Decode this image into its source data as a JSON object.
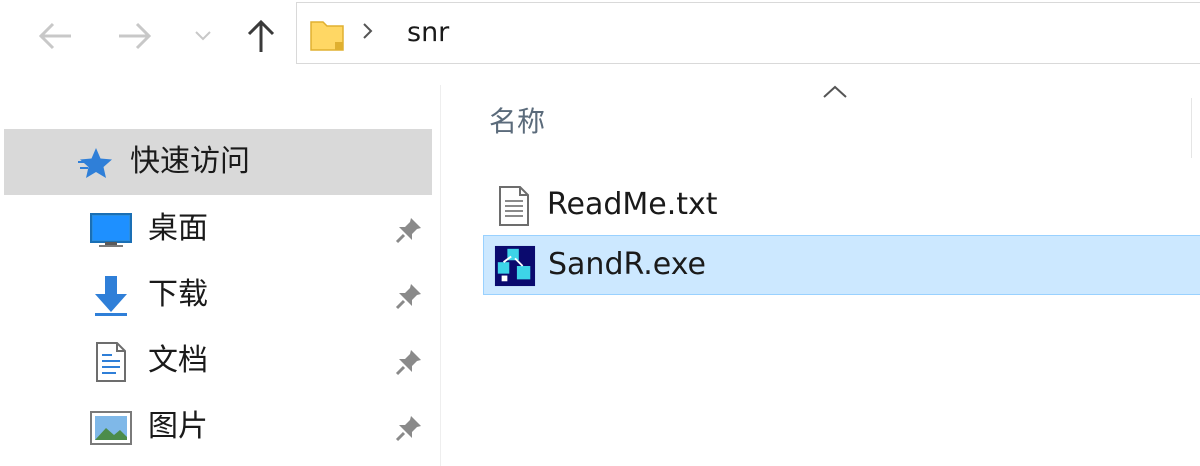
{
  "toolbar": {
    "back_icon": "arrow-left-icon",
    "forward_icon": "arrow-right-icon",
    "recent_icon": "chevron-down-icon",
    "up_icon": "arrow-up-icon"
  },
  "address": {
    "folder_icon": "folder-icon",
    "separator_icon": "chevron-right-icon",
    "crumb": "snr"
  },
  "sidebar": {
    "quick_access": {
      "label": "快速访问",
      "icon": "star-icon"
    },
    "items": [
      {
        "label": "桌面",
        "icon": "desktop-icon",
        "pinned": true
      },
      {
        "label": "下载",
        "icon": "download-icon",
        "pinned": true
      },
      {
        "label": "文档",
        "icon": "document-icon",
        "pinned": true
      },
      {
        "label": "图片",
        "icon": "pictures-icon",
        "pinned": true
      }
    ]
  },
  "main": {
    "column_header": "名称",
    "sort": "ascending",
    "files": [
      {
        "name": "ReadMe.txt",
        "icon": "text-file-icon",
        "selected": false
      },
      {
        "name": "SandR.exe",
        "icon": "exe-icon",
        "selected": true
      }
    ]
  },
  "colors": {
    "selection_bg": "#cce8ff",
    "selection_border": "#99d1ff",
    "quick_access_bg": "#d9d9d9",
    "folder_yellow": "#ffd764",
    "accent_blue": "#1e90ff"
  }
}
